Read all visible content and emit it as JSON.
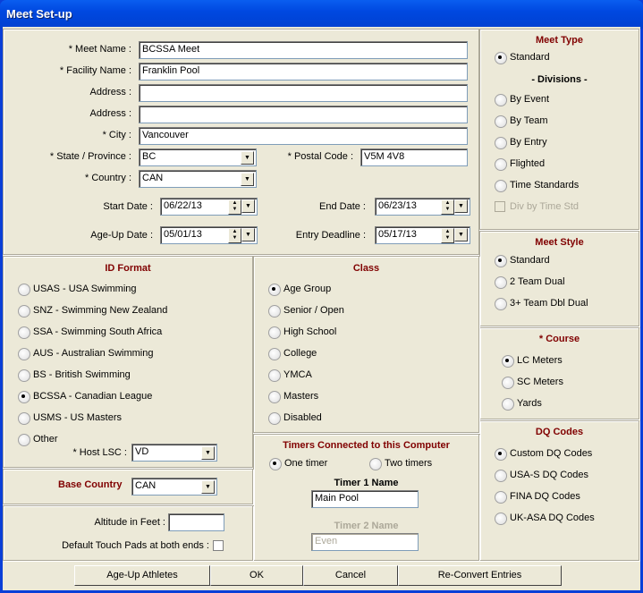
{
  "window": {
    "title": "Meet Set-up"
  },
  "general": {
    "meet_name_label": "* Meet Name :",
    "meet_name": "BCSSA Meet",
    "facility_label": "* Facility Name :",
    "facility": "Franklin Pool",
    "address1_label": "Address :",
    "address1": "",
    "address2_label": "Address :",
    "address2": "",
    "city_label": "* City :",
    "city": "Vancouver",
    "state_label": "* State / Province :",
    "state": "BC",
    "postal_label": "* Postal Code :",
    "postal": "V5M 4V8",
    "country_label": "* Country :",
    "country": "CAN",
    "start_label": "Start Date :",
    "start": "06/22/13",
    "end_label": "End Date :",
    "end": "06/23/13",
    "ageup_label": "Age-Up Date :",
    "ageup": "05/01/13",
    "deadline_label": "Entry Deadline :",
    "deadline": "05/17/13"
  },
  "meet_type": {
    "title": "Meet Type",
    "standard": "Standard",
    "divisions_label": "- Divisions -",
    "options": [
      {
        "label": "By Event",
        "selected": false
      },
      {
        "label": "By Team",
        "selected": false
      },
      {
        "label": "By Entry",
        "selected": false
      },
      {
        "label": "Flighted",
        "selected": false
      },
      {
        "label": "Time Standards",
        "selected": false
      }
    ],
    "div_by_time_std": "Div by Time Std"
  },
  "meet_style": {
    "title": "Meet Style",
    "options": [
      {
        "label": "Standard",
        "selected": true
      },
      {
        "label": "2 Team Dual",
        "selected": false
      },
      {
        "label": "3+ Team Dbl Dual",
        "selected": false
      }
    ]
  },
  "course": {
    "title": "* Course",
    "options": [
      {
        "label": "LC Meters",
        "selected": true
      },
      {
        "label": "SC Meters",
        "selected": false
      },
      {
        "label": "Yards",
        "selected": false
      }
    ]
  },
  "dq_codes": {
    "title": "DQ Codes",
    "options": [
      {
        "label": "Custom DQ Codes",
        "selected": true
      },
      {
        "label": "USA-S DQ Codes",
        "selected": false
      },
      {
        "label": "FINA DQ Codes",
        "selected": false
      },
      {
        "label": "UK-ASA DQ Codes",
        "selected": false
      }
    ]
  },
  "id_format": {
    "title": "ID Format",
    "options": [
      {
        "label": "USAS - USA Swimming",
        "selected": false
      },
      {
        "label": "SNZ - Swimming New Zealand",
        "selected": false
      },
      {
        "label": "SSA - Swimming South Africa",
        "selected": false
      },
      {
        "label": "AUS - Australian Swimming",
        "selected": false
      },
      {
        "label": "BS - British Swimming",
        "selected": false
      },
      {
        "label": "BCSSA - Canadian League",
        "selected": true
      },
      {
        "label": "USMS - US Masters",
        "selected": false
      },
      {
        "label": "Other",
        "selected": false
      }
    ],
    "host_lsc_label": "* Host LSC :",
    "host_lsc": "VD"
  },
  "class": {
    "title": "Class",
    "options": [
      {
        "label": "Age Group",
        "selected": true
      },
      {
        "label": "Senior / Open",
        "selected": false
      },
      {
        "label": "High School",
        "selected": false
      },
      {
        "label": "College",
        "selected": false
      },
      {
        "label": "YMCA",
        "selected": false
      },
      {
        "label": "Masters",
        "selected": false
      },
      {
        "label": "Disabled",
        "selected": false
      }
    ]
  },
  "timers": {
    "title": "Timers Connected to this Computer",
    "one": "One timer",
    "two": "Two timers",
    "timer1_label": "Timer 1 Name",
    "timer1": "Main Pool",
    "timer2_label": "Timer 2 Name",
    "timer2": "Even"
  },
  "base_country": {
    "label": "Base Country",
    "value": "CAN"
  },
  "altitude": {
    "label": "Altitude in Feet :",
    "value": "",
    "touchpads_label": "Default Touch Pads at both ends :"
  },
  "buttons": {
    "ageup": "Age-Up Athletes",
    "ok": "OK",
    "cancel": "Cancel",
    "reconvert": "Re-Convert Entries"
  }
}
